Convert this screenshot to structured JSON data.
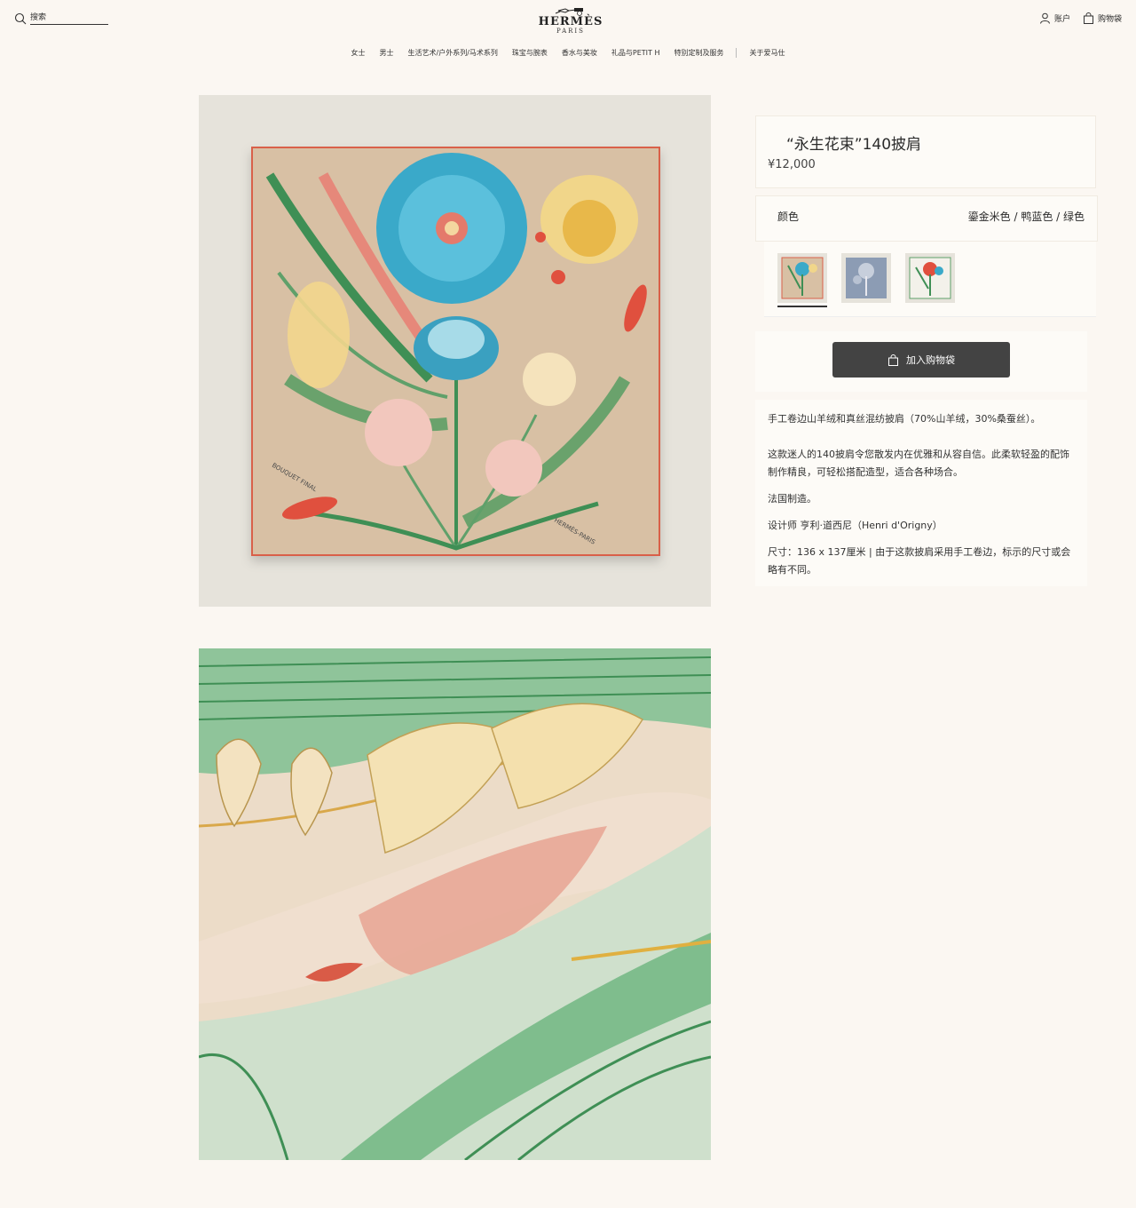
{
  "header": {
    "search_placeholder": "搜索",
    "logo_brand": "HERMÈS",
    "logo_city": "PARIS",
    "account_label": "账户",
    "cart_label": "购物袋"
  },
  "nav": {
    "items": [
      "女士",
      "男士",
      "生活艺术/户外系列/马术系列",
      "珠宝与腕表",
      "香水与美妆",
      "礼品与PETIT H",
      "特别定制及服务",
      "关于爱马仕"
    ]
  },
  "product": {
    "title": "“永生花束”140披肩",
    "price": "¥12,000",
    "color_label": "颜色",
    "color_value": "鎏金米色 / 鸭蓝色 / 绿色",
    "add_to_cart": "加入购物袋",
    "description": [
      "手工卷边山羊绒和真丝混纺披肩（70%山羊绒，30%桑蚕丝）。",
      "这款迷人的140披肩令您散发内在优雅和从容自信。此柔软轻盈的配饰制作精良，可轻松搭配造型，适合各种场合。",
      "法国制造。",
      "设计师 亨利·道西尼（Henri d'Origny）",
      "尺寸：136 x 137厘米 | 由于这款披肩采用手工卷边，标示的尺寸或会略有不同。"
    ],
    "scarf_text_left": "BOUQUET FINAL",
    "scarf_text_right": "HERMÈS-PARIS"
  },
  "colors": {
    "accent_button": "#434343",
    "page_bg": "#fbf7f2",
    "scarf_bg": "#d8c0a4",
    "scarf_border": "#d9604a"
  }
}
